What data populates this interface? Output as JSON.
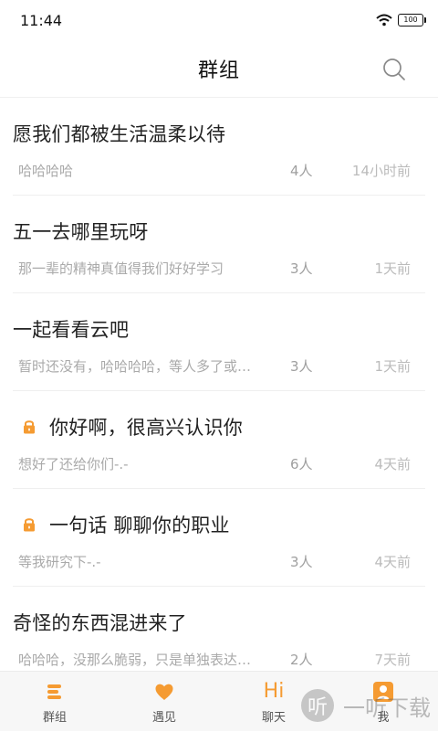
{
  "status_bar": {
    "time": "11:44",
    "battery": "100"
  },
  "header": {
    "title": "群组"
  },
  "groups": [
    {
      "name": "愿我们都被生活温柔以待",
      "preview": "哈哈哈哈",
      "members": "4人",
      "time": "14小时前",
      "locked": false
    },
    {
      "name": "五一去哪里玩呀",
      "preview": "那一辈的精神真值得我们好好学习",
      "members": "3人",
      "time": "1天前",
      "locked": false
    },
    {
      "name": "一起看看云吧",
      "preview": "暂时还没有，哈哈哈哈，等人多了或…",
      "members": "3人",
      "time": "1天前",
      "locked": false
    },
    {
      "name": "你好啊，很高兴认识你",
      "preview": "想好了还给你们-.-",
      "members": "6人",
      "time": "4天前",
      "locked": true
    },
    {
      "name": "一句话 聊聊你的职业",
      "preview": "等我研究下-.-",
      "members": "3人",
      "time": "4天前",
      "locked": true
    },
    {
      "name": "奇怪的东西混进来了",
      "preview": "哈哈哈，没那么脆弱，只是单独表达…",
      "members": "2人",
      "time": "7天前",
      "locked": false
    }
  ],
  "bottom_nav": {
    "items": [
      {
        "label": "群组",
        "icon": "group-icon"
      },
      {
        "label": "遇见",
        "icon": "heart-icon"
      },
      {
        "label": "聊天",
        "icon": "hi-chat-icon",
        "icon_text": "Hi"
      },
      {
        "label": "我",
        "icon": "profile-icon"
      }
    ]
  },
  "watermark": {
    "logo_text": "听",
    "text": "一听下载"
  },
  "colors": {
    "accent": "#f59b32",
    "background": "#ffffff",
    "divider": "#efefef",
    "muted_text": "#aaaaaa"
  }
}
